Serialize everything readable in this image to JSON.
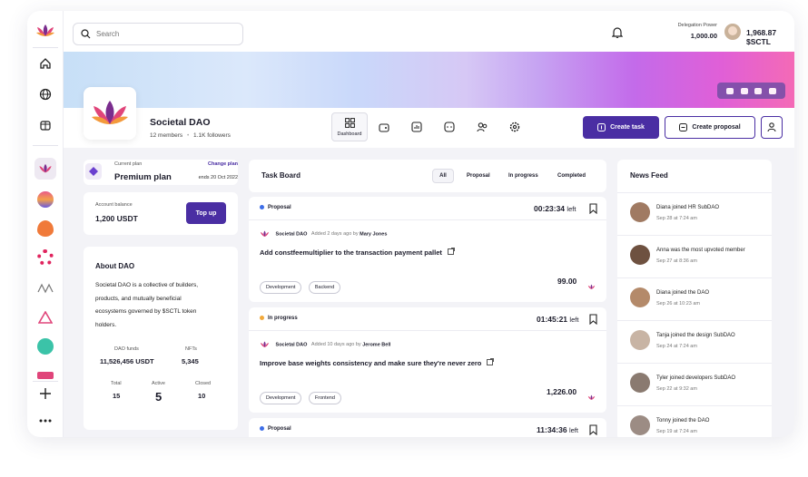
{
  "topbar": {
    "search_placeholder": "Search",
    "delegation_label": "Delegation Power",
    "delegation_value": "1,000.00",
    "balance": "1,968.87 $SCTL"
  },
  "dao": {
    "name": "Societal DAO",
    "members": "12 members",
    "followers": "1.1K followers"
  },
  "tabs": [
    {
      "label": "Dashboard",
      "icon": "dashboard-icon"
    },
    {
      "label": "",
      "icon": "treasury-icon"
    },
    {
      "label": "",
      "icon": "stats-icon"
    },
    {
      "label": "",
      "icon": "chat-icon"
    },
    {
      "label": "",
      "icon": "members-icon"
    },
    {
      "label": "",
      "icon": "settings-icon"
    }
  ],
  "actions": {
    "create_task": "Create task",
    "create_proposal": "Create proposal"
  },
  "plan": {
    "label": "Current plan",
    "name": "Premium plan",
    "change": "Change plan",
    "ends": "ends 20 Oct 2022"
  },
  "account": {
    "label": "Account balance",
    "value": "1,200 USDT",
    "topup": "Top up"
  },
  "about": {
    "title": "About DAO",
    "text_lines": [
      "Societal DAO is a collective of builders,",
      "products, and mutually beneficial",
      "ecosystems governed by $SCTL token",
      "holders."
    ],
    "funds_label": "DAO funds",
    "funds_value": "11,526,456 USDT",
    "nfts_label": "NFTs",
    "nfts_value": "5,345",
    "total_label": "Total",
    "total_value": "15",
    "active_label": "Active",
    "active_value": "5",
    "closed_label": "Closed",
    "closed_value": "10"
  },
  "taskboard": {
    "title": "Task Board",
    "filters": [
      "All",
      "Proposal",
      "In progress",
      "Completed"
    ],
    "time_suffix": "left",
    "tasks": [
      {
        "status": "Proposal",
        "status_color": "#3d6ee8",
        "timer": "00:23:34",
        "dao": "Societal DAO",
        "meta_pre": "Added 2 days ago by",
        "author": "Mary Jones",
        "title": "Add constfeemultiplier to the transaction payment pallet",
        "tags": [
          "Development",
          "Backend"
        ],
        "amount": "99.00"
      },
      {
        "status": "In progress",
        "status_color": "#f2a93b",
        "timer": "01:45:21",
        "dao": "Societal DAO",
        "meta_pre": "Added 10 days ago by",
        "author": "Jerome Bell",
        "title": "Improve base weights consistency and make sure they're never zero",
        "tags": [
          "Development",
          "Frontend"
        ],
        "amount": "1,226.00"
      },
      {
        "status": "Proposal",
        "status_color": "#3d6ee8",
        "timer": "11:34:36",
        "dao": "",
        "meta_pre": "",
        "author": "",
        "title": "",
        "tags": [],
        "amount": ""
      }
    ]
  },
  "news": {
    "title": "News Feed",
    "items": [
      {
        "text": "Diana joined HR SubDAO",
        "date": "Sep 28 at 7:24 am",
        "avatar_color": "#a07a62"
      },
      {
        "text": "Anna was the most upvoted member",
        "date": "Sep 27 at 8:36 am",
        "avatar_color": "#6e5140"
      },
      {
        "text": "Diana joined the DAO",
        "date": "Sep 26 at 10:23 am",
        "avatar_color": "#b48a6a"
      },
      {
        "text": "Tanja joined the design SubDAO",
        "date": "Sep 24 at 7:24 am",
        "avatar_color": "#c8b4a4"
      },
      {
        "text": "Tyler joined developers SubDAO",
        "date": "Sep 22 at 9:32 am",
        "avatar_color": "#8a7a70"
      },
      {
        "text": "Tonny joined the DAO",
        "date": "Sep 19 at 7:24 am",
        "avatar_color": "#9c8c84"
      }
    ]
  },
  "colors": {
    "accent": "#4a2ea3",
    "lotus": "#c0347a"
  }
}
